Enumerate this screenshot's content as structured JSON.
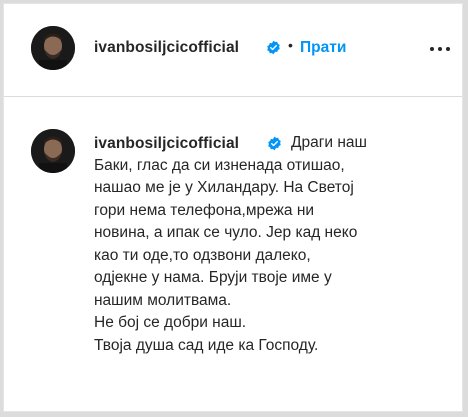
{
  "header": {
    "username": "ivanbosiljcicofficial",
    "separator": "•",
    "follow_label": "Прати",
    "icons": {
      "verified": "verified-badge-icon",
      "more": "more-options-icon"
    },
    "accent_color": "#0095f6"
  },
  "caption": {
    "username": "ivanbosiljcicofficial",
    "lines": [
      "Драги наш",
      "Баки, глас да си изненада отишао,",
      "нашао ме је у Хиландару. На Светој",
      "гори нема телефона,мрежа ни",
      "новина, а ипак се чуло. Јер кад неко",
      "као ти оде,то одзвони далеко,",
      "одјекне у нама. Бруји твоје име у",
      "нашим молитвама.",
      "Не бој се добри наш.",
      "Твоја душа сад иде ка Господу."
    ]
  }
}
